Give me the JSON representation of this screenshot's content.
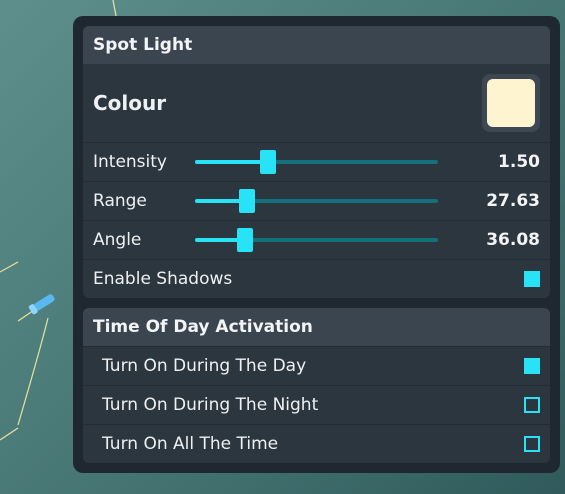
{
  "spot_light": {
    "title": "Spot Light",
    "colour_label": "Colour",
    "colour_value": "#fff4d0",
    "sliders": [
      {
        "label": "Intensity",
        "value": "1.50",
        "fraction": 0.3
      },
      {
        "label": "Range",
        "value": "27.63",
        "fraction": 0.215
      },
      {
        "label": "Angle",
        "value": "36.08",
        "fraction": 0.205
      }
    ],
    "enable_shadows_label": "Enable Shadows",
    "enable_shadows_checked": true
  },
  "time_of_day": {
    "title": "Time Of Day Activation",
    "options": [
      {
        "label": "Turn On During The Day",
        "checked": true
      },
      {
        "label": "Turn On During The Night",
        "checked": false
      },
      {
        "label": "Turn On All The Time",
        "checked": false
      }
    ]
  },
  "colors": {
    "accent": "#27e3f5",
    "track": "#14707d",
    "panel": "#1f2830"
  }
}
